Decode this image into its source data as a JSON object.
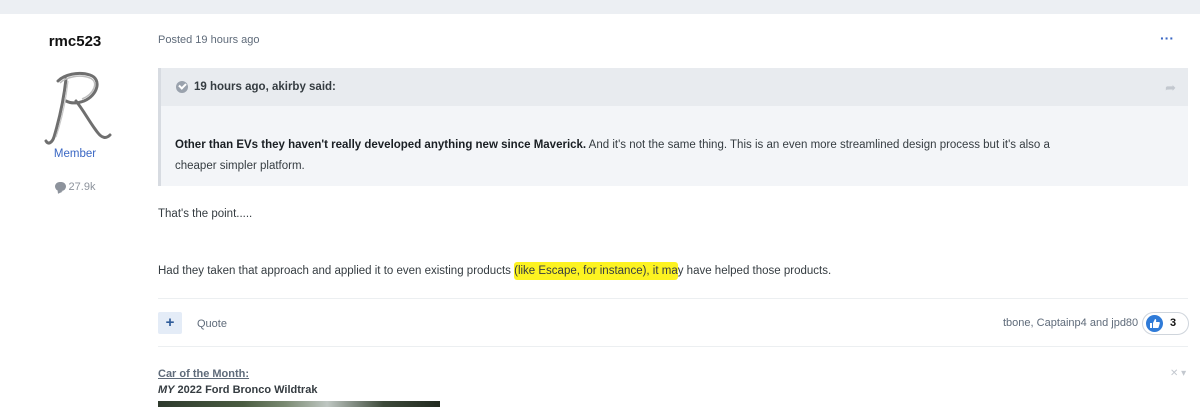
{
  "author": {
    "name": "rmc523",
    "group": "Member",
    "post_count": "27.9k",
    "avatar_letter": "R"
  },
  "post": {
    "posted": "Posted 19 hours ago",
    "more_icon": "ellipsis-icon",
    "quote": {
      "citation": "19 hours ago, akirby said:",
      "bold": "Other than EVs they haven't really developed anything new since Maverick.",
      "rest_line1": "  And it's not the same thing.  This is an even more streamlined design process but it's also a",
      "rest_line2": "cheaper simpler platform."
    },
    "para1": "That's the point.....",
    "para2_before": "Had they taken that approach and applied it to even existing products ",
    "para2_highlight": "(like Escape, for instance), it ma",
    "para2_after": "y have helped those products.",
    "highlight_color": "#fdf321"
  },
  "footer": {
    "plus_label": "+",
    "quote_label": "Quote",
    "reaction_users": "tbone, Captainp4 and jpd80",
    "reaction_count": "3",
    "reaction_icon": "thumbs-up-icon",
    "accent": "#2f7bd8"
  },
  "signature": {
    "title": "Car of the Month:",
    "my_prefix": "MY",
    "car": " 2022 Ford Bronco Wildtrak",
    "close_label": "✕ ▾"
  }
}
